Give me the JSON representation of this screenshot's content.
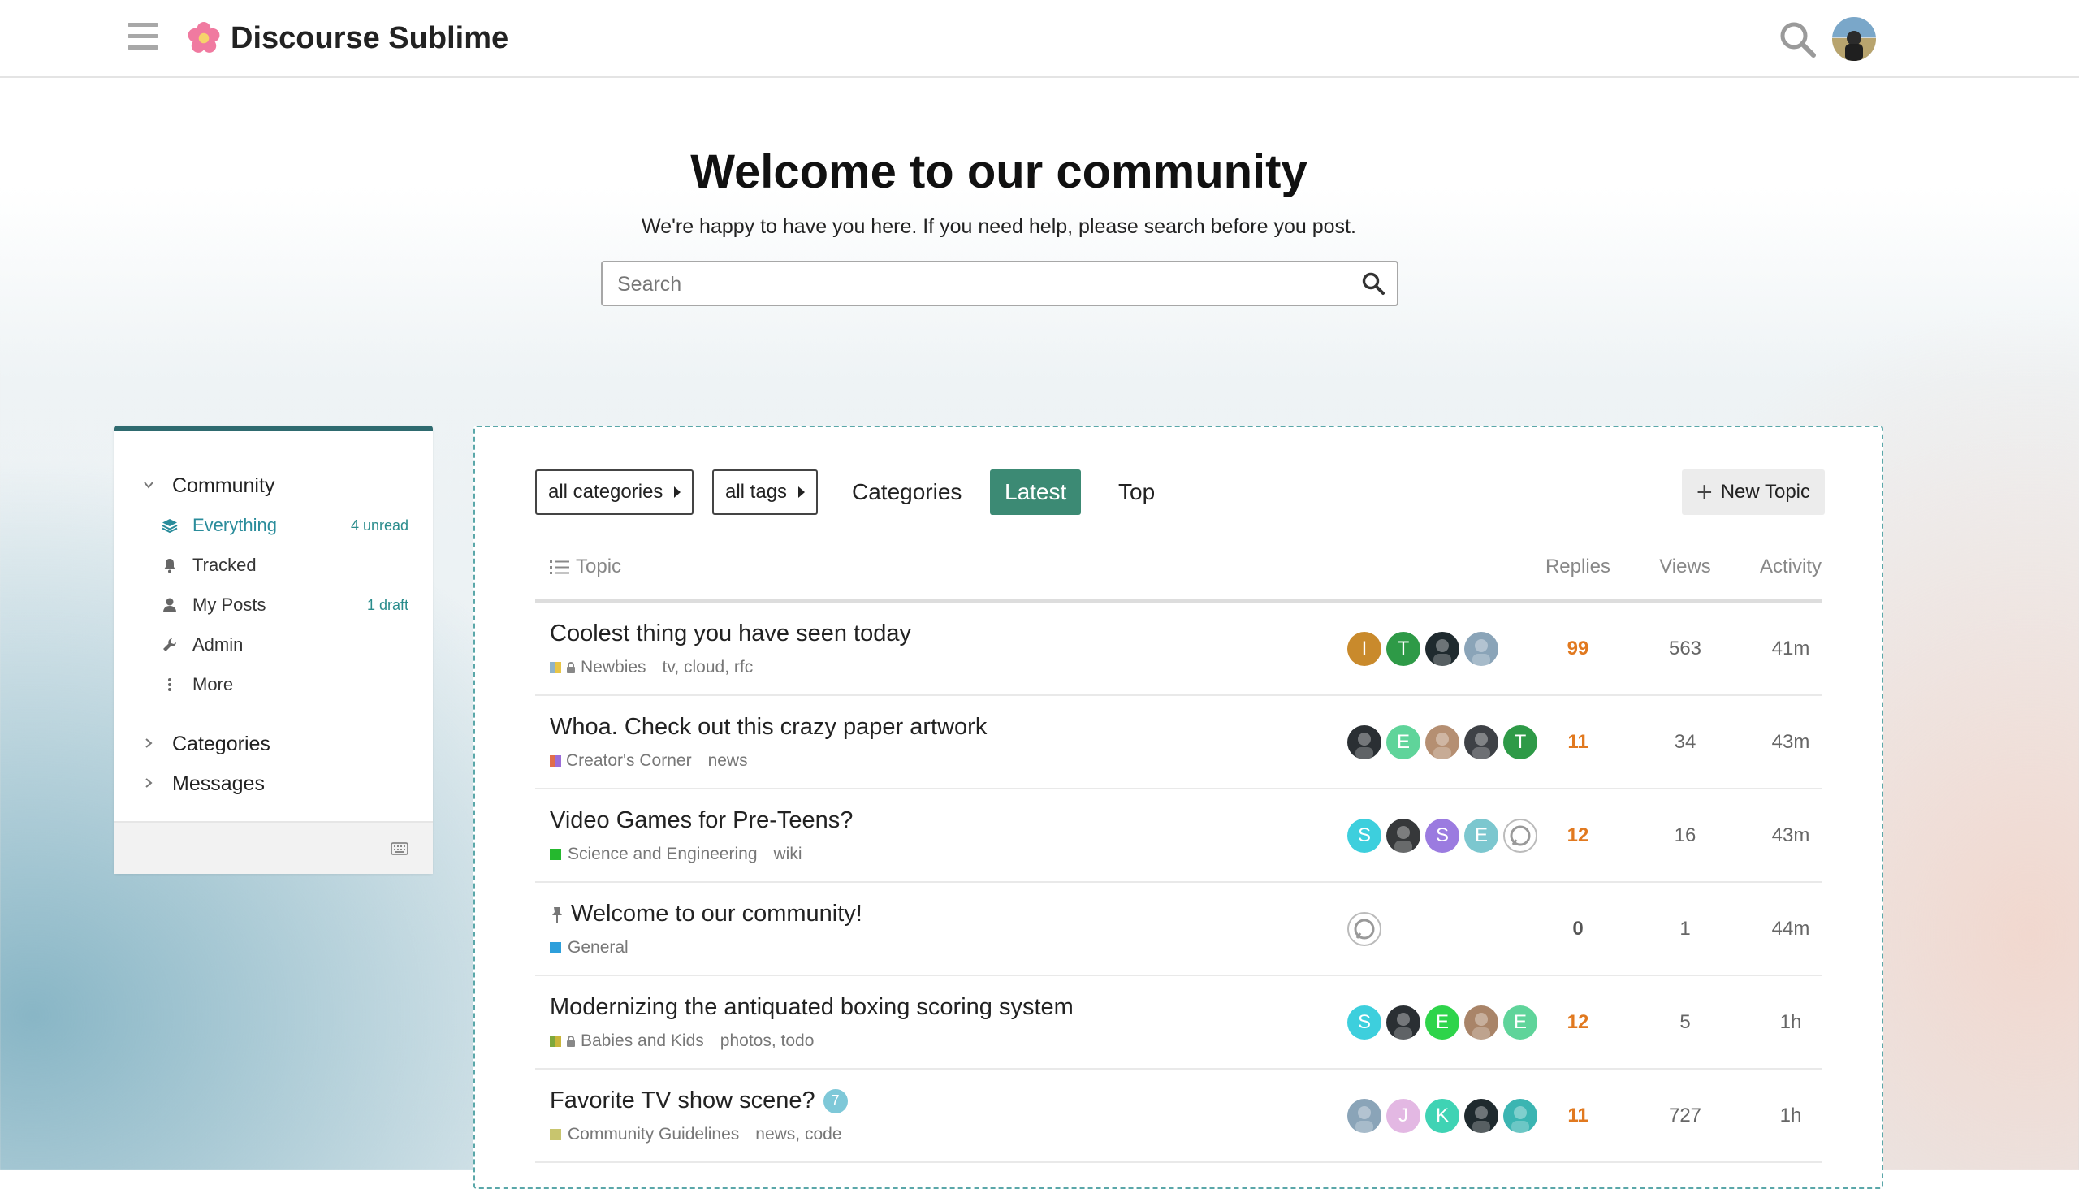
{
  "header": {
    "site_title": "Discourse Sublime",
    "logo_icon": "flower-logo",
    "search_icon": "search-icon",
    "avatar": "user-avatar"
  },
  "banner": {
    "title": "Welcome to our community",
    "subtitle": "We're happy to have you here. If you need help, please search before you post.",
    "search_placeholder": "Search"
  },
  "sidebar": {
    "community": {
      "title": "Community"
    },
    "links": [
      {
        "label": "Everything",
        "count": "4 unread",
        "icon": "layers-icon",
        "active": true
      },
      {
        "label": "Tracked",
        "count": "",
        "icon": "bell-icon"
      },
      {
        "label": "My Posts",
        "count": "1 draft",
        "icon": "user-icon"
      },
      {
        "label": "Admin",
        "count": "",
        "icon": "wrench-icon"
      },
      {
        "label": "More",
        "count": "",
        "icon": "ellipsis-vertical-icon"
      }
    ],
    "categories": {
      "title": "Categories"
    },
    "messages": {
      "title": "Messages"
    }
  },
  "toolbar": {
    "categories_drop": "all categories",
    "tags_drop": "all tags",
    "tabs": [
      "Categories",
      "Latest",
      "Top"
    ],
    "active_tab": "Latest",
    "new_topic": "New Topic"
  },
  "columns": {
    "topic": "Topic",
    "replies": "Replies",
    "views": "Views",
    "activity": "Activity"
  },
  "colors": {
    "accent": "#3c8a74",
    "sidebar_accent": "#2e6a6f",
    "replies": "#e1791f",
    "link": "#2a8c9b"
  },
  "topics": [
    {
      "title": "Coolest thing you have seen today",
      "category": "Newbies",
      "locked": true,
      "cat_colors": [
        "#8fb3c9",
        "#e8c547"
      ],
      "tags": [
        "tv",
        "cloud",
        "rfc"
      ],
      "replies": "99",
      "views": "563",
      "activity": "41m"
    },
    {
      "title": "Whoa. Check out this crazy paper artwork",
      "category": "Creator's Corner",
      "cat_colors": [
        "#e06d4b",
        "#9b6cd8"
      ],
      "tags": [
        "news"
      ],
      "replies": "11",
      "views": "34",
      "activity": "43m"
    },
    {
      "title": "Video Games for Pre-Teens?",
      "category": "Science and Engineering",
      "cat_colors": [
        "#25b82e"
      ],
      "tags": [
        "wiki"
      ],
      "replies": "12",
      "views": "16",
      "activity": "43m"
    },
    {
      "title": "Welcome to our community!",
      "pinned": true,
      "category": "General",
      "cat_colors": [
        "#2d9fdb"
      ],
      "tags": [],
      "replies": "0",
      "views": "1",
      "activity": "44m"
    },
    {
      "title": "Modernizing the antiquated boxing scoring system",
      "category": "Babies and Kids",
      "locked": true,
      "cat_colors": [
        "#7ea83c",
        "#c9b53a"
      ],
      "tags": [
        "photos",
        "todo"
      ],
      "replies": "12",
      "views": "5",
      "activity": "1h"
    },
    {
      "title": "Favorite TV show scene?",
      "badge": "7",
      "category": "Community Guidelines",
      "cat_colors": [
        "#c8c56e"
      ],
      "tags": [
        "news",
        "code"
      ],
      "replies": "11",
      "views": "727",
      "activity": "1h"
    }
  ],
  "posters": [
    [
      {
        "letter": "I",
        "color": "#c98a2c"
      },
      {
        "letter": "T",
        "color": "#2e9a47"
      },
      {
        "letter": "",
        "color": "#1f2a2e"
      },
      {
        "letter": "",
        "color": "#8aa4b8"
      }
    ],
    [
      {
        "letter": "",
        "color": "#2a2f33"
      },
      {
        "letter": "E",
        "color": "#5fd49a"
      },
      {
        "letter": "",
        "color": "#b58f72"
      },
      {
        "letter": "",
        "color": "#3e4146"
      },
      {
        "letter": "T",
        "color": "#2e9a47"
      }
    ],
    [
      {
        "letter": "S",
        "color": "#3dcfdd"
      },
      {
        "letter": "",
        "color": "#36383a"
      },
      {
        "letter": "S",
        "color": "#9b7be0"
      },
      {
        "letter": "E",
        "color": "#7cc7cf"
      },
      {
        "letter": "",
        "color": "#ffffff"
      }
    ],
    [
      {
        "letter": "",
        "color": "#ffffff"
      }
    ],
    [
      {
        "letter": "S",
        "color": "#3dcfdd"
      },
      {
        "letter": "",
        "color": "#2a2f33"
      },
      {
        "letter": "E",
        "color": "#2ed44a"
      },
      {
        "letter": "",
        "color": "#a98468"
      },
      {
        "letter": "E",
        "color": "#5fd49a"
      }
    ],
    [
      {
        "letter": "",
        "color": "#8aa4b8"
      },
      {
        "letter": "J",
        "color": "#e3b8e3"
      },
      {
        "letter": "K",
        "color": "#3fd3b4"
      },
      {
        "letter": "",
        "color": "#1f2a2e"
      },
      {
        "letter": "",
        "color": "#3bb5b2"
      }
    ]
  ]
}
